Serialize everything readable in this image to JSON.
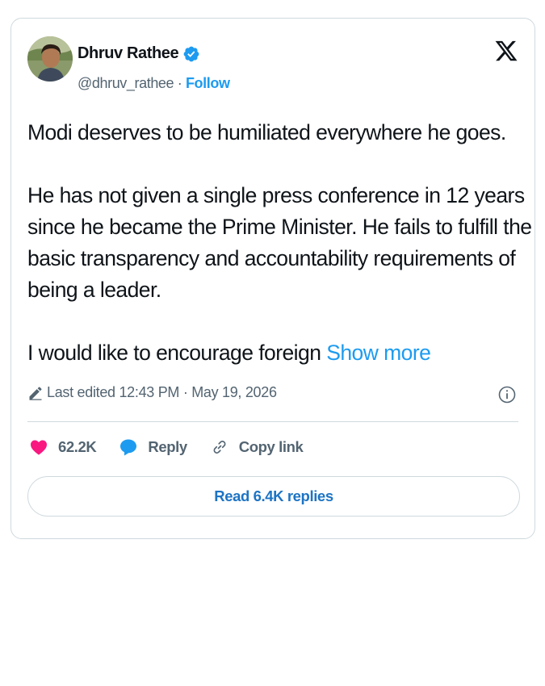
{
  "author": {
    "name": "Dhruv Rathee",
    "handle": "@dhruv_rathee",
    "separator": " · ",
    "follow_label": "Follow",
    "verified_icon": "verified-badge-icon",
    "avatar_icon": "profile-photo"
  },
  "brand_icon": "x-logo-icon",
  "tweet": {
    "lines": [
      "Modi deserves to be humiliated everywhere he goes.",
      "He has not given a single press conference in 12 years",
      "since he became the Prime Minister. He fails to fulfill the",
      "basic transparency and accountability requirements of",
      "being a leader.",
      "I would like to encourage foreign "
    ],
    "show_more_label": "Show more"
  },
  "meta": {
    "edited_text": "Last edited 12:43 PM · May 19, 2026",
    "edit_icon": "pencil-icon",
    "info_icon": "info-icon"
  },
  "actions": {
    "like_count": "62.2K",
    "reply_label": "Reply",
    "copy_label": "Copy link"
  },
  "read_replies_label": "Read 6.4K replies",
  "colors": {
    "accent": "#1d9bf0",
    "like": "#f91880",
    "text": "#0f1419",
    "muted": "#536471",
    "border": "#cfd9de"
  }
}
